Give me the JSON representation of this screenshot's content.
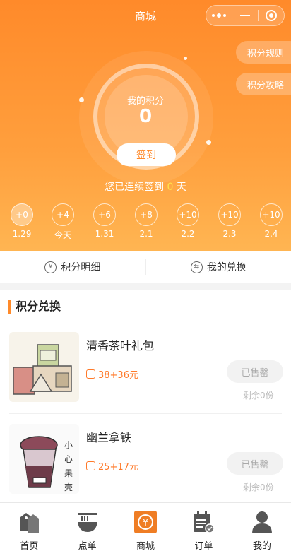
{
  "header": {
    "title": "商城"
  },
  "side_buttons": {
    "rules": "积分规则",
    "guide": "积分攻略"
  },
  "points": {
    "label": "我的积分",
    "value": "0",
    "signin_label": "签到"
  },
  "streak": {
    "prefix": "您已连续签到 ",
    "days": "0",
    "suffix": " 天"
  },
  "checkin_days": [
    {
      "reward": "+0",
      "date": "1.29",
      "done": true
    },
    {
      "reward": "+4",
      "date": "今天",
      "done": false
    },
    {
      "reward": "+6",
      "date": "1.31",
      "done": false
    },
    {
      "reward": "+8",
      "date": "2.1",
      "done": false
    },
    {
      "reward": "+10",
      "date": "2.2",
      "done": false
    },
    {
      "reward": "+10",
      "date": "2.3",
      "done": false
    },
    {
      "reward": "+10",
      "date": "2.4",
      "done": false
    }
  ],
  "tabs": {
    "detail": "积分明细",
    "exchange": "我的兑换"
  },
  "section": {
    "title": "积分兑换"
  },
  "products": [
    {
      "name": "清香茶叶礼包",
      "price": "38+36元",
      "status": "已售罄",
      "remain": "剩余0份"
    },
    {
      "name": "幽兰拿铁",
      "price": "25+17元",
      "status": "已售罄",
      "remain": "剩余0份"
    }
  ],
  "tabbar": [
    {
      "label": "首页",
      "icon": "home-tag-icon"
    },
    {
      "label": "点单",
      "icon": "bowl-icon"
    },
    {
      "label": "商城",
      "icon": "shop-yen-icon",
      "active": true
    },
    {
      "label": "订单",
      "icon": "order-list-icon"
    },
    {
      "label": "我的",
      "icon": "person-icon"
    }
  ],
  "colors": {
    "brand": "#ff8a2a",
    "streak_num": "#ffe24a",
    "price": "#ff7a2a"
  }
}
